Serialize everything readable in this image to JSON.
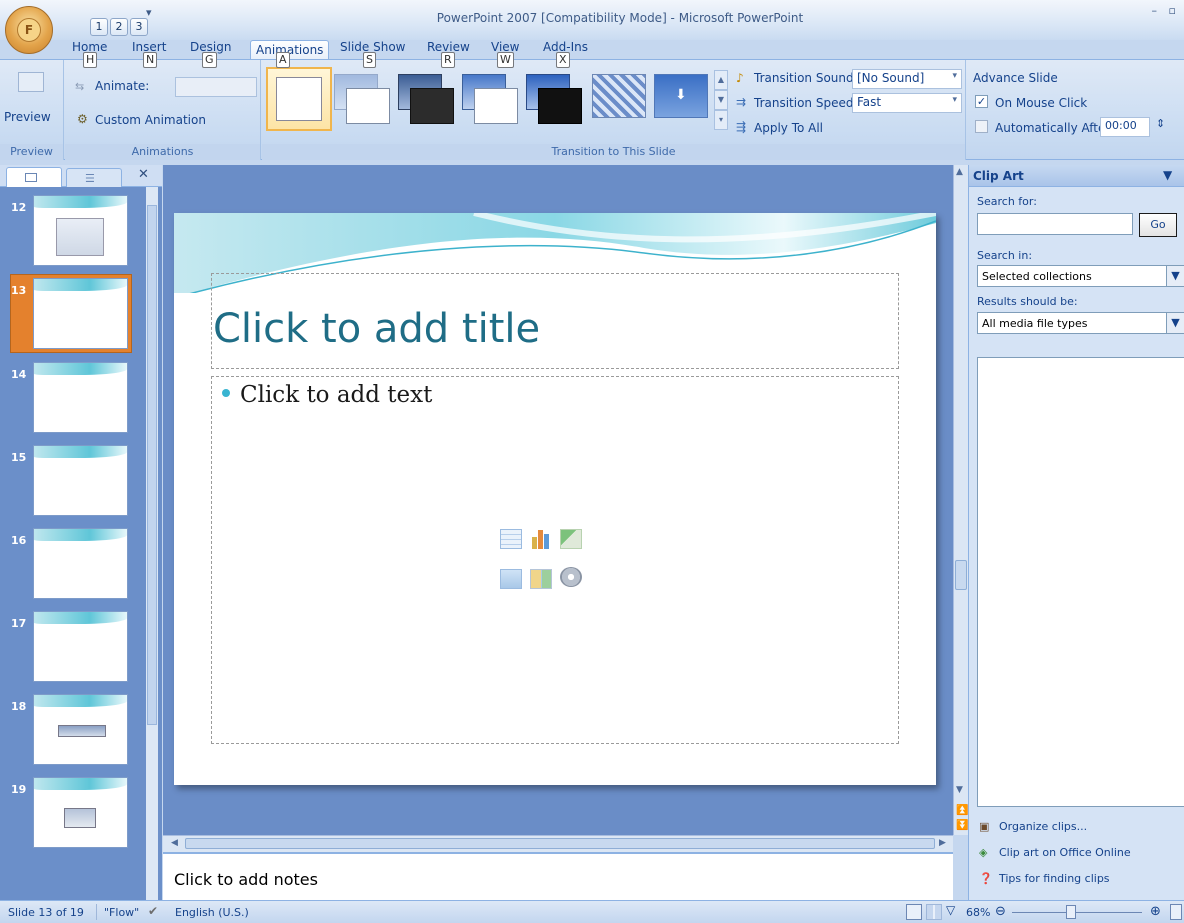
{
  "window": {
    "title": "PowerPoint 2007 [Compatibility Mode] - Microsoft PowerPoint",
    "controls": "– ▫"
  },
  "office_button": {
    "keytip": "F"
  },
  "qat": {
    "keytips": [
      "1",
      "2",
      "3"
    ],
    "more": "▾"
  },
  "tabs": [
    {
      "label": "Home",
      "keytip": "H"
    },
    {
      "label": "Insert",
      "keytip": "N"
    },
    {
      "label": "Design",
      "keytip": "G"
    },
    {
      "label": "Animations",
      "keytip": "A"
    },
    {
      "label": "Slide Show",
      "keytip": "S"
    },
    {
      "label": "Review",
      "keytip": "R"
    },
    {
      "label": "View",
      "keytip": "W"
    },
    {
      "label": "Add-Ins",
      "keytip": "X"
    }
  ],
  "ribbon": {
    "preview": {
      "button_label": "Preview",
      "group_label": "Preview"
    },
    "animations": {
      "animate_label": "Animate:",
      "custom_animation": "Custom Animation",
      "group_label": "Animations"
    },
    "transition": {
      "sound_label": "Transition Sound:",
      "sound_value": "[No Sound]",
      "speed_label": "Transition Speed:",
      "speed_value": "Fast",
      "apply_all": "Apply To All",
      "group_label": "Transition to This Slide"
    },
    "advance": {
      "title": "Advance Slide",
      "on_mouse_click": "On Mouse Click",
      "on_mouse_click_checked": true,
      "auto_after": "Automatically After:",
      "auto_value": "00:00"
    }
  },
  "slides_pane": {
    "close": "✕",
    "thumbnails": [
      {
        "num": "12",
        "selected": false
      },
      {
        "num": "13",
        "selected": true
      },
      {
        "num": "14",
        "selected": false
      },
      {
        "num": "15",
        "selected": false
      },
      {
        "num": "16",
        "selected": false
      },
      {
        "num": "17",
        "selected": false
      },
      {
        "num": "18",
        "selected": false
      },
      {
        "num": "19",
        "selected": false
      }
    ]
  },
  "slide": {
    "title_placeholder": "Click to add title",
    "body_placeholder": "Click to add text"
  },
  "notes": {
    "placeholder": "Click to add notes"
  },
  "clip_art": {
    "title": "Clip Art",
    "search_for": "Search for:",
    "search_value": "",
    "go": "Go",
    "search_in": "Search in:",
    "search_in_value": "Selected collections",
    "results_label": "Results should be:",
    "results_value": "All media file types",
    "links": [
      "Organize clips...",
      "Clip art on Office Online",
      "Tips for finding clips"
    ]
  },
  "status": {
    "slide": "Slide 13 of 19",
    "theme": "\"Flow\"",
    "language": "English (U.S.)",
    "zoom": "68%"
  },
  "colors": {
    "accent": "#15428b",
    "selected_slide": "#e4812d",
    "title_text": "#1f6d86",
    "bullet": "#38b4d1"
  }
}
